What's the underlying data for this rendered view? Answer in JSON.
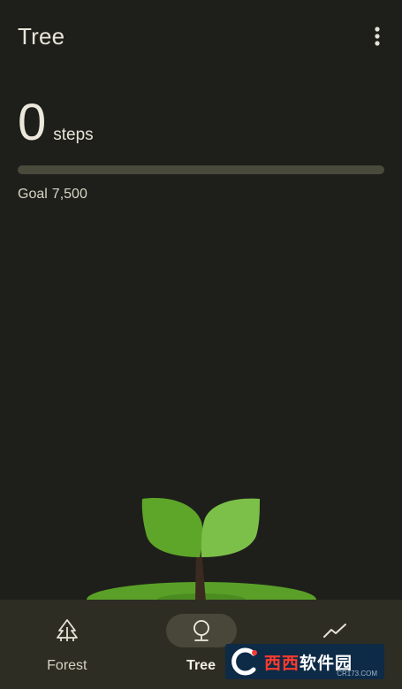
{
  "header": {
    "title": "Tree",
    "menu_icon": "more-vertical-icon"
  },
  "steps": {
    "value": "0",
    "unit": "steps",
    "progress": 0
  },
  "goal": {
    "label": "Goal",
    "value": "7,500"
  },
  "colors": {
    "background": "#1e1f1a",
    "nav_background": "#2d2d23",
    "leaf_dark": "#5ea62a",
    "leaf_light": "#7cc04a",
    "ground": "#5aa028",
    "trunk": "#3b2a1f",
    "active_pill": "#48473a"
  },
  "nav": {
    "items": [
      {
        "label": "Forest",
        "icon": "forest-icon",
        "active": false
      },
      {
        "label": "Tree",
        "icon": "tree-icon",
        "active": true
      },
      {
        "label": "",
        "icon": "trend-chart-icon",
        "active": false
      }
    ]
  },
  "watermark": {
    "brand_red": "西西",
    "brand_white": "软件园",
    "url": "CR173.COM"
  }
}
